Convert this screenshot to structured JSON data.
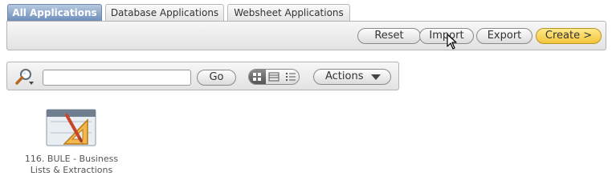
{
  "tabs": [
    {
      "label": "All Applications"
    },
    {
      "label": "Database Applications"
    },
    {
      "label": "Websheet Applications"
    }
  ],
  "toolbar": {
    "reset_label": "Reset",
    "import_label": "Import",
    "export_label": "Export",
    "create_label": "Create >"
  },
  "search": {
    "value": "",
    "go_label": "Go",
    "actions_label": "Actions",
    "view_modes": [
      "icons",
      "report",
      "details"
    ],
    "active_view": "icons"
  },
  "applications": [
    {
      "label_line1": "116. BULE - Business",
      "label_line2": "Lists & Extractions",
      "icon": "application-icon"
    }
  ],
  "colors": {
    "active_tab": "#6e8eb9",
    "create_button": "#f4c53c"
  }
}
